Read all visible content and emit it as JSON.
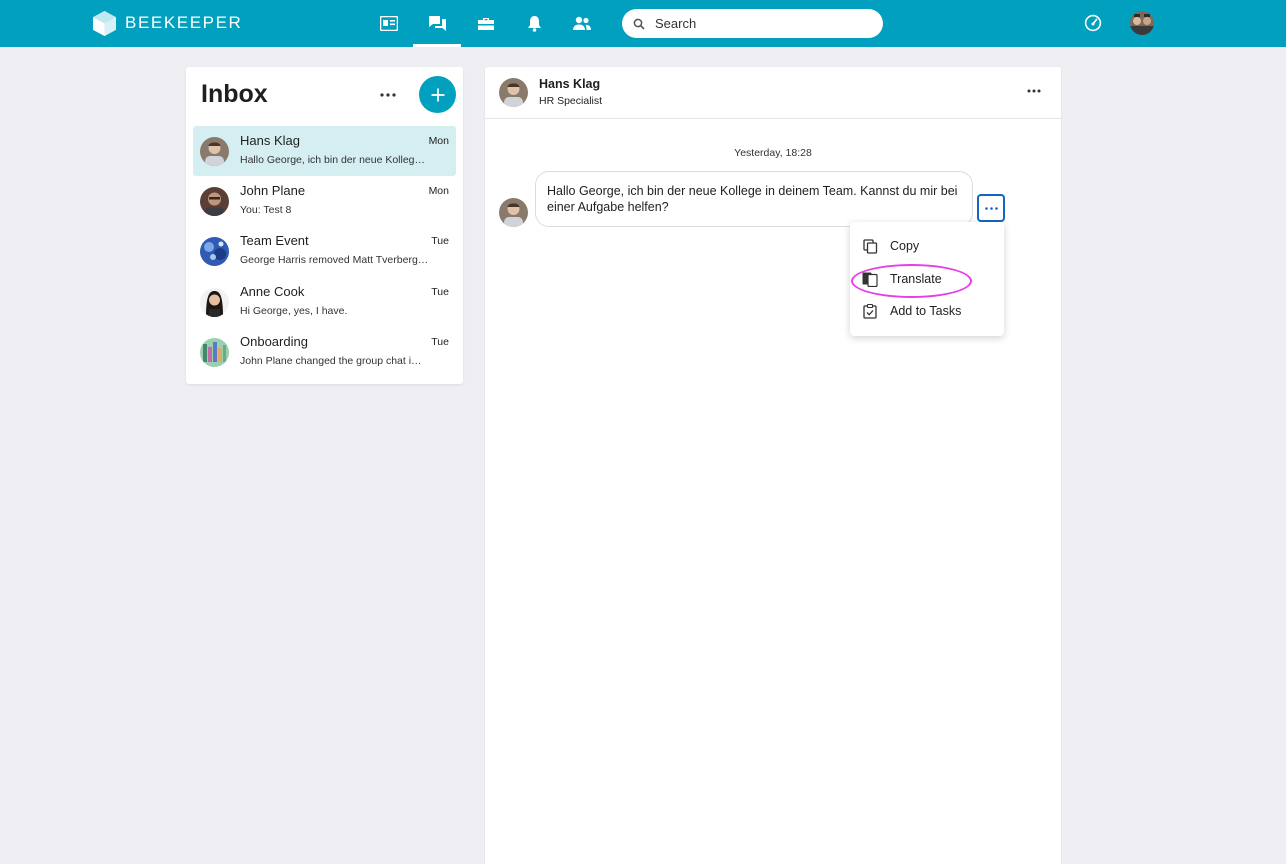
{
  "topbar": {
    "logo_text": "BEEKEEPER",
    "search_placeholder": "Search",
    "nav_icons": [
      "news-feed-icon",
      "chat-icon",
      "toolbox-icon",
      "notifications-icon",
      "people-icon"
    ],
    "active_nav": "chat-icon",
    "colors": {
      "bar": "#00a0be",
      "accent": "#00a0be"
    }
  },
  "inbox": {
    "title": "Inbox",
    "conversations": [
      {
        "name": "Hans Klag",
        "day": "Mon",
        "preview": "Hallo George, ich bin der neue Kollege in deinem Team. Kannst du mir bei einer Aufgabe helfen?",
        "active": true
      },
      {
        "name": "John Plane",
        "day": "Mon",
        "preview": "You: Test 8"
      },
      {
        "name": "Team Event",
        "day": "Tue",
        "preview": "George Harris removed Matt Tverberg from the group chat"
      },
      {
        "name": "Anne Cook",
        "day": "Tue",
        "preview": "Hi George, yes, I have."
      },
      {
        "name": "Onboarding",
        "day": "Tue",
        "preview": "John Plane changed the group chat image"
      }
    ]
  },
  "chat": {
    "name": "Hans Klag",
    "role": "HR Specialist",
    "timestamp": "Yesterday, 18:28",
    "message": "Hallo George, ich bin der neue Kollege in deinem Team. Kannst du mir bei einer Aufgabe helfen?"
  },
  "context_menu": {
    "items": [
      {
        "label": "Copy",
        "icon": "copy-icon"
      },
      {
        "label": "Translate",
        "icon": "translate-icon"
      },
      {
        "label": "Add to Tasks",
        "icon": "task-icon"
      }
    ]
  }
}
